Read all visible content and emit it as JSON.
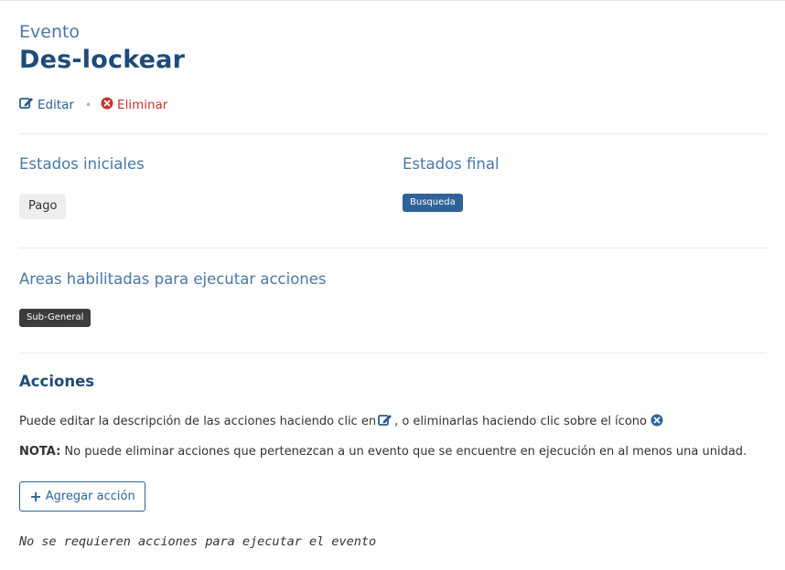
{
  "header": {
    "subtitle": "Evento",
    "title": "Des-lockear"
  },
  "actions": {
    "edit_label": "Editar",
    "separator": "•",
    "delete_label": "Eliminar"
  },
  "states": {
    "initial_title": "Estados iniciales",
    "initial_items": [
      "Pago"
    ],
    "final_title": "Estados final",
    "final_items": [
      "Busqueda"
    ]
  },
  "areas": {
    "title": "Areas habilitadas para ejecutar acciones",
    "items": [
      "Sub-General"
    ]
  },
  "acciones": {
    "title": "Acciones",
    "help_before": "Puede editar la descripción de las acciones haciendo clic en",
    "help_middle": ", o eliminarlas haciendo clic sobre el ícono",
    "note_label": "NOTA:",
    "note_text": " No puede eliminar acciones que pertenezcan a un evento que se encuentre en ejecución en al menos una unidad.",
    "add_button": "Agregar acción",
    "empty_message": "No se requieren acciones para ejecutar el evento"
  },
  "colors": {
    "accent": "#2e6399",
    "title": "#1e4b77",
    "danger": "#c9302c"
  },
  "icons": {
    "edit": "edit-icon",
    "delete": "times-circle-icon",
    "add": "plus-icon"
  }
}
